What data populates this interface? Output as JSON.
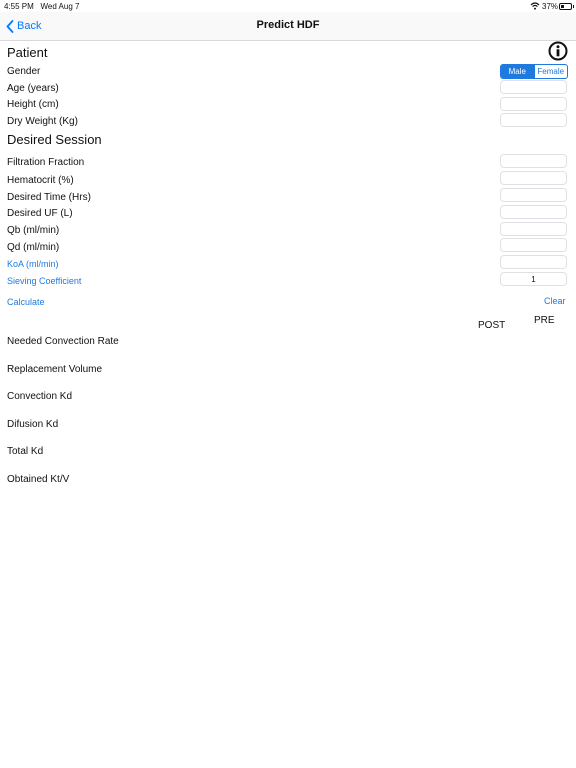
{
  "status_bar": {
    "time": "4:55 PM",
    "date": "Wed Aug 7",
    "battery": "37%"
  },
  "nav": {
    "back_label": "Back",
    "title": "Predict HDF"
  },
  "patient": {
    "title": "Patient",
    "gender_label": "Gender",
    "gender_options": [
      "Male",
      "Female"
    ],
    "selected_gender": "Male",
    "age_label": "Age (years)",
    "height_label": "Height (cm)",
    "dry_weight_label": "Dry Weight (Kg)"
  },
  "session": {
    "title": "Desired Session",
    "filtration_fraction_label": "Filtration Fraction",
    "hematocrit_label": "Hematocrit (%)",
    "desired_time_label": "Desired Time (Hrs)",
    "desired_uf_label": "Desired UF (L)",
    "qb_label": "Qb (ml/min)",
    "qd_label": "Qd (ml/min)",
    "koa_label": "KoA (ml/min)",
    "sieving_label": "Sieving Coefficient",
    "sieving_value": "1"
  },
  "actions": {
    "calculate": "Calculate",
    "clear": "Clear"
  },
  "results": {
    "post_header": "POST",
    "pre_header": "PRE",
    "needed_convection_rate": "Needed Convection Rate",
    "replacement_volume": "Replacement Volume",
    "convection_kd": "Convection Kd",
    "difusion_kd": "Difusion Kd",
    "total_kd": "Total Kd",
    "obtained_ktv": "Obtained Kt/V"
  },
  "colors": {
    "accent": "#1f7ae0",
    "back_blue": "#007aff",
    "border": "#e1e1e5"
  },
  "icons": {
    "back": "chevron-left-icon",
    "info": "info-circle-icon",
    "wifi": "wifi-icon",
    "battery": "battery-icon"
  }
}
